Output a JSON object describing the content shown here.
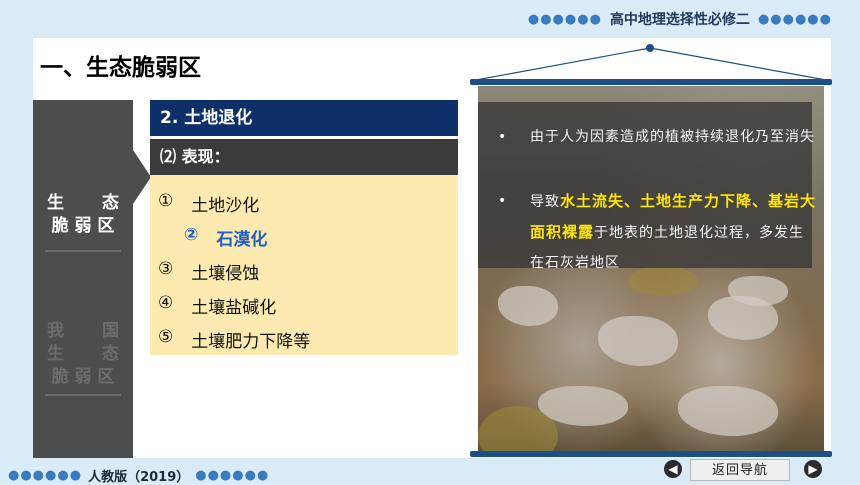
{
  "header": {
    "dots_left": "●●●●●●",
    "title": "高中地理选择性必修二",
    "dots_right": "●●●●●●"
  },
  "page_title": "一、生态脆弱区",
  "sidebar": {
    "active": {
      "line1_a": "生",
      "line1_b": "态",
      "line2": "脆 弱 区"
    },
    "inactive": {
      "line1_a": "我",
      "line1_b": "国",
      "line2_a": "生",
      "line2_b": "态",
      "line3": "脆 弱 区"
    }
  },
  "section": {
    "heading": "2.   土地退化",
    "subheading": "⑵ 表现：",
    "items": [
      {
        "num": "①",
        "text": "土地沙化"
      },
      {
        "num": "②",
        "text": "石漠化"
      },
      {
        "num": "③",
        "text": "土壤侵蚀"
      },
      {
        "num": "④",
        "text": "土壤盐碱化"
      },
      {
        "num": "⑤",
        "text": "土壤肥力下降等"
      }
    ]
  },
  "photo_text": {
    "bullet1": "由于人为因素造成的植被持续退化乃至消失",
    "bullet2_pre": "导致",
    "bullet2_hl": "水土流失、土地生产力下降、基岩大面积裸露",
    "bullet2_post": "于地表的土地退化过程，多发生在石灰岩地区",
    "bullet_mark": "•"
  },
  "footer": {
    "dots_left": "●●●●●●",
    "edition": "人教版（2019）",
    "dots_right": "●●●●●●",
    "prev_icon": "◀",
    "back_label": "返回导航",
    "next_icon": "▶"
  },
  "colors": {
    "navy": "#0f2f6b",
    "highlight_blue": "#1e5fc8",
    "highlight_yellow": "#ffe400",
    "list_bg": "#fdeab0"
  }
}
